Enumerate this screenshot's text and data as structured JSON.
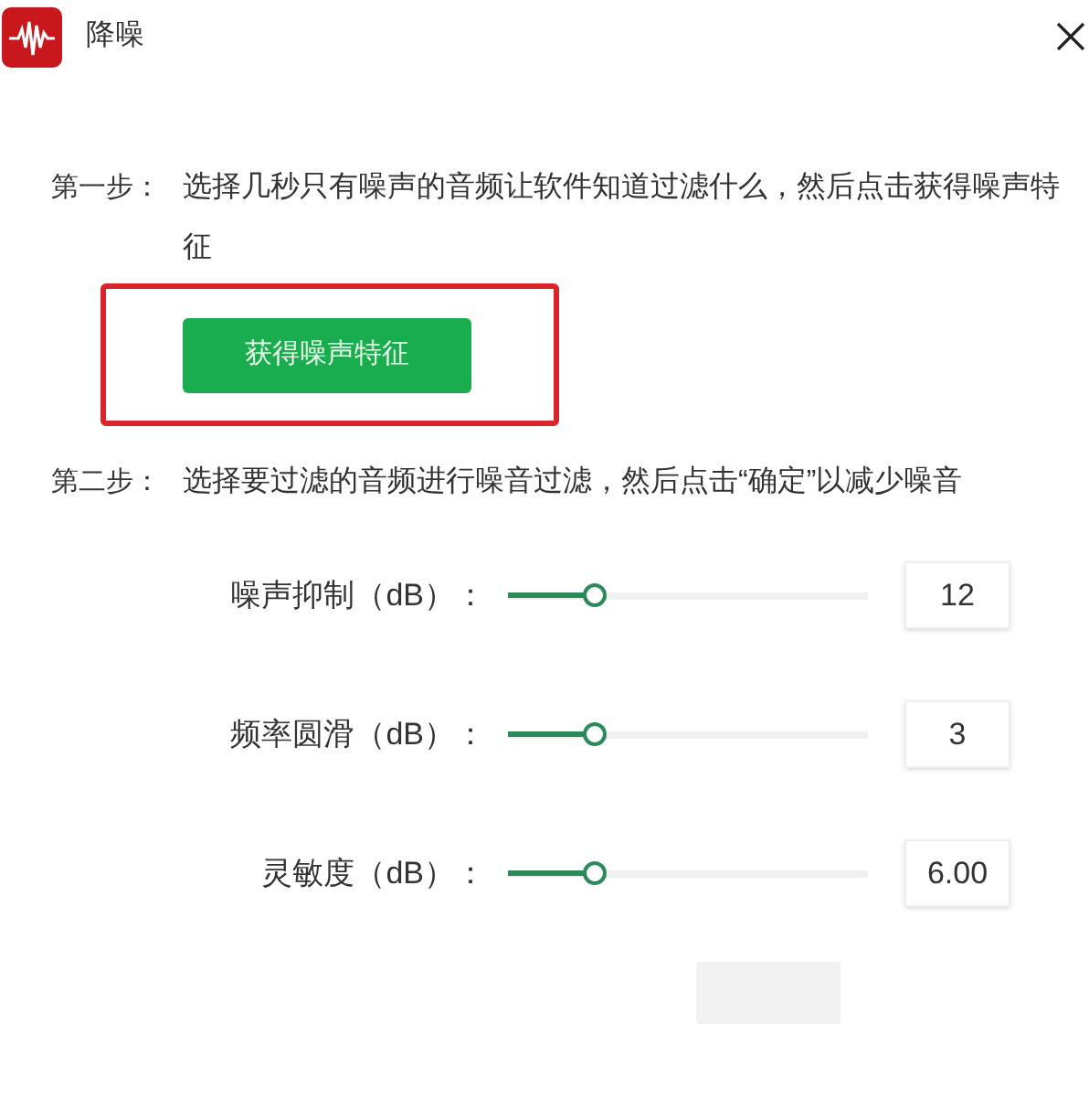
{
  "window": {
    "title": "降噪"
  },
  "steps": [
    {
      "label": "第一步：",
      "text": "选择几秒只有噪声的音频让软件知道过滤什么，然后点击获得噪声特征"
    },
    {
      "label": "第二步：",
      "text": "选择要过滤的音频进行噪音过滤，然后点击“确定”以减少噪音"
    }
  ],
  "feature_button": {
    "label": "获得噪声特征",
    "highlighted": true
  },
  "sliders": [
    {
      "name": "噪声抑制（dB）：",
      "level": 0.24,
      "value": "12"
    },
    {
      "name": "频率圆滑（dB）：",
      "level": 0.24,
      "value": "3"
    },
    {
      "name": "灵敏度（dB）：",
      "level": 0.24,
      "value": "6.00"
    }
  ],
  "confirm_button": {
    "disabled": true
  }
}
